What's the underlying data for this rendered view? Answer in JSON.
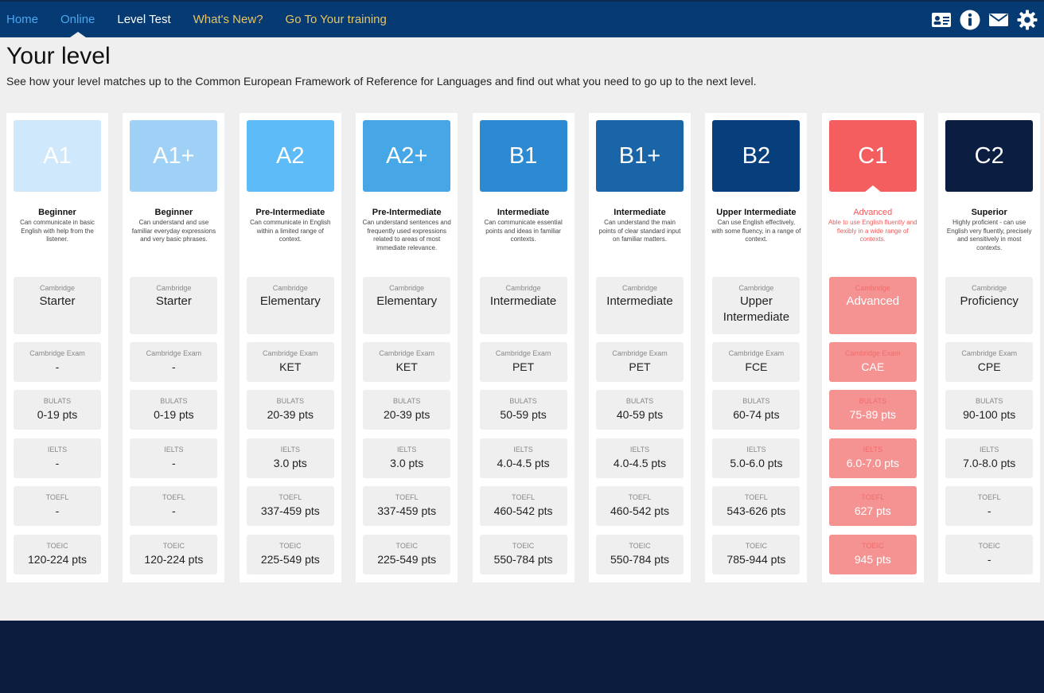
{
  "nav": {
    "items": [
      {
        "label": "Home",
        "color": "#4aa8f0",
        "current": false
      },
      {
        "label": "Online",
        "color": "#4aa8f0",
        "current": true
      },
      {
        "label": "Level Test",
        "color": "#ffffff",
        "current": false
      },
      {
        "label": "What's New?",
        "color": "#e8c463",
        "current": false
      },
      {
        "label": "Go To Your training",
        "color": "#e8c463",
        "current": false
      }
    ],
    "icons": [
      "contact-card-icon",
      "info-icon",
      "mail-icon",
      "gear-icon"
    ]
  },
  "page": {
    "title": "Your level",
    "subtitle": "See how your level matches up to the Common European Framework of Reference for Languages and find out what you need to go up to the next level."
  },
  "labels": {
    "cambridge": "Cambridge",
    "cambridge_exam": "Cambridge Exam",
    "bulats": "BULATS",
    "ielts": "IELTS",
    "toefl": "TOEFL",
    "toeic": "TOEIC"
  },
  "levels": [
    {
      "code": "A1",
      "color": "#cfe8fb",
      "name": "Beginner",
      "desc": "Can communicate in basic English with help from the listener.",
      "cambridge": "Starter",
      "exam": "-",
      "bulats": "0-19 pts",
      "ielts": "-",
      "toefl": "-",
      "toeic": "120-224 pts"
    },
    {
      "code": "A1+",
      "color": "#9fd1f6",
      "name": "Beginner",
      "desc": "Can understand and use familiar everyday expressions and very basic phrases.",
      "cambridge": "Starter",
      "exam": "-",
      "bulats": "0-19 pts",
      "ielts": "-",
      "toefl": "-",
      "toeic": "120-224 pts"
    },
    {
      "code": "A2",
      "color": "#5dbcf7",
      "name": "Pre-Intermediate",
      "desc": "Can communicate in English within a limited range of context.",
      "cambridge": "Elementary",
      "exam": "KET",
      "bulats": "20-39 pts",
      "ielts": "3.0 pts",
      "toefl": "337-459 pts",
      "toeic": "225-549 pts"
    },
    {
      "code": "A2+",
      "color": "#47a6e6",
      "name": "Pre-Intermediate",
      "desc": "Can understand sentences and frequently used expressions related to areas of most immediate relevance.",
      "cambridge": "Elementary",
      "exam": "KET",
      "bulats": "20-39 pts",
      "ielts": "3.0 pts",
      "toefl": "337-459 pts",
      "toeic": "225-549 pts"
    },
    {
      "code": "B1",
      "color": "#2b8ad2",
      "name": "Intermediate",
      "desc": "Can communicate essential points and ideas in familiar contexts.",
      "cambridge": "Intermediate",
      "exam": "PET",
      "bulats": "50-59 pts",
      "ielts": "4.0-4.5 pts",
      "toefl": "460-542 pts",
      "toeic": "550-784 pts"
    },
    {
      "code": "B1+",
      "color": "#1a64a8",
      "name": "Intermediate",
      "desc": "Can understand the main points of clear standard input on familiar matters.",
      "cambridge": "Intermediate",
      "exam": "PET",
      "bulats": "40-59 pts",
      "ielts": "4.0-4.5 pts",
      "toefl": "460-542 pts",
      "toeic": "550-784 pts"
    },
    {
      "code": "B2",
      "color": "#063f7c",
      "name": "Upper Intermediate",
      "desc": "Can use English effectively, with some fluency, in a range of context.",
      "cambridge": "Upper Intermediate",
      "exam": "FCE",
      "bulats": "60-74 pts",
      "ielts": "5.0-6.0 pts",
      "toefl": "543-626 pts",
      "toeic": "785-944 pts"
    },
    {
      "code": "C1",
      "color": "#f45e5e",
      "name": "Advanced",
      "desc": "Able to use English fluently and flexibly in a wide range of contexts.",
      "cambridge": "Advanced",
      "exam": "CAE",
      "bulats": "75-89 pts",
      "ielts": "6.0-7.0 pts",
      "toefl": "627 pts",
      "toeic": "945 pts",
      "current": true
    },
    {
      "code": "C2",
      "color": "#0b1d40",
      "name": "Superior",
      "desc": "Highly proficient - can use English very fluently, precisely and sensitively in most contexts.",
      "cambridge": "Proficiency",
      "exam": "CPE",
      "bulats": "90-100 pts",
      "ielts": "7.0-8.0 pts",
      "toefl": "-",
      "toeic": "-"
    }
  ]
}
